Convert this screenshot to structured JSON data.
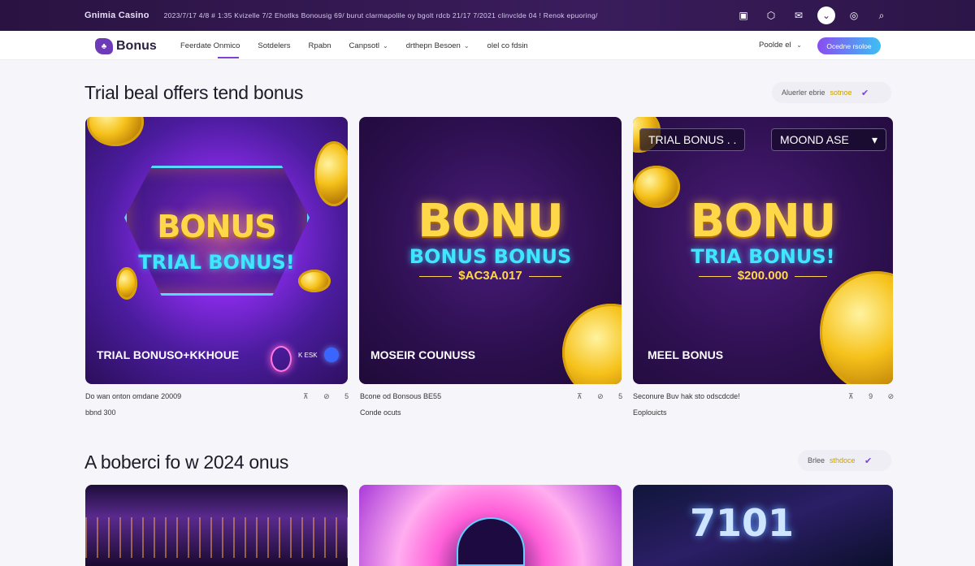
{
  "topbar": {
    "brand": "Gnimia Casino",
    "ticker": "2023/7/17    4/8 # 1:35 Kvizelle 7/2    Ehotlks Bonousig    69/ burut clarmapolile oy bgolt rdcb    21/17 7/2021 clinvclde 04 !   Renok epuoring/",
    "icons": [
      "wallet-icon",
      "shield-icon",
      "mail-icon",
      "chevron-down-icon",
      "globe-icon",
      "search-icon"
    ]
  },
  "nav": {
    "logo": "Bonus",
    "items": [
      {
        "label": "Feerdate Onmico",
        "caret": false,
        "active": true
      },
      {
        "label": "Sotdelers",
        "caret": false,
        "active": false
      },
      {
        "label": "Rpabn",
        "caret": false,
        "active": false
      },
      {
        "label": "Canpsotl",
        "caret": true,
        "active": false
      },
      {
        "label": "drthepn Besoen",
        "caret": true,
        "active": false
      },
      {
        "label": "olel co fdsin",
        "caret": false,
        "active": false
      }
    ],
    "right_label": "Poolde el",
    "cta": "Ocedne rsoloe"
  },
  "section1": {
    "title": "Trial beal offers tend bonus",
    "filter": "Aluerler ebrie",
    "filter_value": "sotnoe"
  },
  "cards": [
    {
      "title": "BONUS",
      "subtitle": "TRIAL BONUS!",
      "label": "TRIAL BONUSO+KKHOUE",
      "badge": "K ESK",
      "meta": "Do wan onton omdane 20009",
      "meta2": "bbnd 300",
      "stats": "⊼ ⊘ 5"
    },
    {
      "title": "BONU",
      "subtitle": "BONUS BONUS",
      "amount": "$AC3A.017",
      "label": "MOSEIR COUNUSS",
      "meta": "Bcone od Bonsous BE55",
      "meta2": "Conde ocuts",
      "stats": "⊼ ⊘ 5"
    },
    {
      "title": "BONU",
      "subtitle": "TRIA BONUS!",
      "amount": "$200.000",
      "tag_left": "TRIAL BONUS . .",
      "tag_right": "MOOND  ASE",
      "label": "MEEL BONUS",
      "meta": "Seconure Buv hak sto odscdcde!",
      "meta2": "Eoplouicts",
      "stats": "⊼ 9 ⊘"
    }
  ],
  "section2": {
    "title": "A boberci fo w 2024 onus",
    "filter": "Brlee",
    "filter_value": "sthdoce"
  },
  "colors": {
    "topbar": "#2a1342",
    "accent": "#7b42d8",
    "cta_start": "#8b4cf0",
    "cta_end": "#3cc0f3"
  }
}
